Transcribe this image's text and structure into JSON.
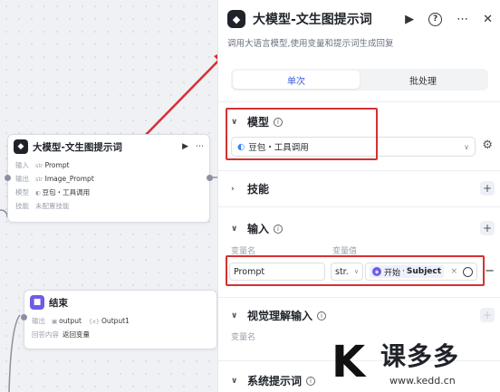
{
  "canvas": {
    "llm_node": {
      "title": "大模型-文生图提示词",
      "rows": [
        {
          "label": "输入",
          "type": "str",
          "value": "Prompt"
        },
        {
          "label": "输出",
          "type": "str",
          "value": "Image_Prompt"
        },
        {
          "label": "模型",
          "type": "",
          "value": "豆包・工具调用"
        },
        {
          "label": "技能",
          "type": "",
          "value": "未配置技能"
        }
      ]
    },
    "end_node": {
      "title": "结束",
      "rows": [
        {
          "label": "输出",
          "type": "",
          "value": "output",
          "extra": "Output1"
        },
        {
          "label": "回答内容",
          "type": "",
          "value": "返回变量"
        }
      ]
    }
  },
  "panel": {
    "title": "大模型-文生图提示词",
    "description": "调用大语言模型,使用变量和提示词生成回复",
    "tabs": [
      "单次",
      "批处理"
    ],
    "sections": {
      "model": {
        "label": "模型",
        "value": "豆包・工具调用"
      },
      "skills": {
        "label": "技能"
      },
      "input": {
        "label": "输入",
        "col_name": "变量名",
        "col_value": "变量值",
        "row": {
          "name": "Prompt",
          "type": "str.",
          "ref_source": "开始",
          "ref_var": "Subject"
        }
      },
      "vision": {
        "label": "视觉理解输入",
        "col_name": "变量名"
      },
      "system_prompt": {
        "label": "系统提示词"
      }
    }
  },
  "watermark": {
    "brand": "课多多",
    "url": "www.kedd.cn"
  },
  "colors": {
    "accent": "#3b5bdb",
    "highlight": "#d63031",
    "end_node": "#6d5ce7"
  }
}
